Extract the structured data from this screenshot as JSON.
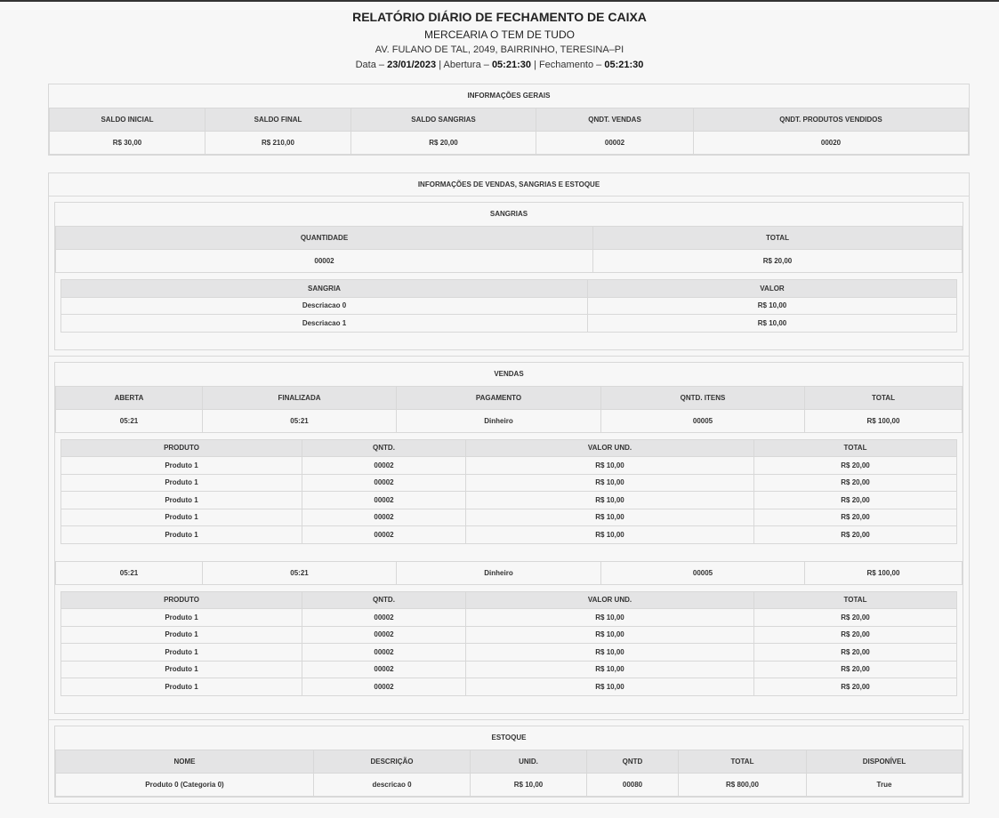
{
  "header": {
    "title": "RELATÓRIO DIÁRIO DE FECHAMENTO DE CAIXA",
    "store": "MERCEARIA O TEM DE TUDO",
    "address": "AV. FULANO DE TAL, 2049, BAIRRINHO, TERESINA–PI",
    "date_label": "Data –",
    "date": "23/01/2023",
    "open_label": "| Abertura –",
    "open_time": "05:21:30",
    "close_label": "| Fechamento –",
    "close_time": "05:21:30"
  },
  "general": {
    "caption": "INFORMAÇÕES GERAIS",
    "headers": [
      "SALDO INICIAL",
      "SALDO FINAL",
      "SALDO SANGRIAS",
      "QNDT. VENDAS",
      "QNDT. PRODUTOS VENDIDOS"
    ],
    "values": [
      "R$ 30,00",
      "R$ 210,00",
      "R$ 20,00",
      "00002",
      "00020"
    ]
  },
  "details": {
    "caption": "INFORMAÇÕES DE VENDAS, SANGRIAS E ESTOQUE"
  },
  "sangrias": {
    "caption": "SANGRIAS",
    "headers": [
      "QUANTIDADE",
      "TOTAL"
    ],
    "values": [
      "00002",
      "R$ 20,00"
    ],
    "item_headers": [
      "SANGRIA",
      "VALOR"
    ],
    "items": [
      [
        "Descriacao 0",
        "R$ 10,00"
      ],
      [
        "Descriacao 1",
        "R$ 10,00"
      ]
    ]
  },
  "vendas": {
    "caption": "VENDAS",
    "headers": [
      "ABERTA",
      "FINALIZADA",
      "PAGAMENTO",
      "QNTD. ITENS",
      "TOTAL"
    ],
    "product_headers": [
      "PRODUTO",
      "QNTD.",
      "VALOR UND.",
      "TOTAL"
    ],
    "sales": [
      {
        "values": [
          "05:21",
          "05:21",
          "Dinheiro",
          "00005",
          "R$ 100,00"
        ],
        "products": [
          [
            "Produto 1",
            "00002",
            "R$ 10,00",
            "R$ 20,00"
          ],
          [
            "Produto 1",
            "00002",
            "R$ 10,00",
            "R$ 20,00"
          ],
          [
            "Produto 1",
            "00002",
            "R$ 10,00",
            "R$ 20,00"
          ],
          [
            "Produto 1",
            "00002",
            "R$ 10,00",
            "R$ 20,00"
          ],
          [
            "Produto 1",
            "00002",
            "R$ 10,00",
            "R$ 20,00"
          ]
        ]
      },
      {
        "values": [
          "05:21",
          "05:21",
          "Dinheiro",
          "00005",
          "R$ 100,00"
        ],
        "products": [
          [
            "Produto 1",
            "00002",
            "R$ 10,00",
            "R$ 20,00"
          ],
          [
            "Produto 1",
            "00002",
            "R$ 10,00",
            "R$ 20,00"
          ],
          [
            "Produto 1",
            "00002",
            "R$ 10,00",
            "R$ 20,00"
          ],
          [
            "Produto 1",
            "00002",
            "R$ 10,00",
            "R$ 20,00"
          ],
          [
            "Produto 1",
            "00002",
            "R$ 10,00",
            "R$ 20,00"
          ]
        ]
      }
    ]
  },
  "estoque": {
    "caption": "ESTOQUE",
    "headers": [
      "NOME",
      "DESCRIÇÃO",
      "UNID.",
      "QNTD",
      "TOTAL",
      "DISPONÍVEL"
    ],
    "rows": [
      [
        "Produto 0 (Categoria 0)",
        "descricao 0",
        "R$ 10,00",
        "00080",
        "R$ 800,00",
        "True"
      ]
    ]
  }
}
